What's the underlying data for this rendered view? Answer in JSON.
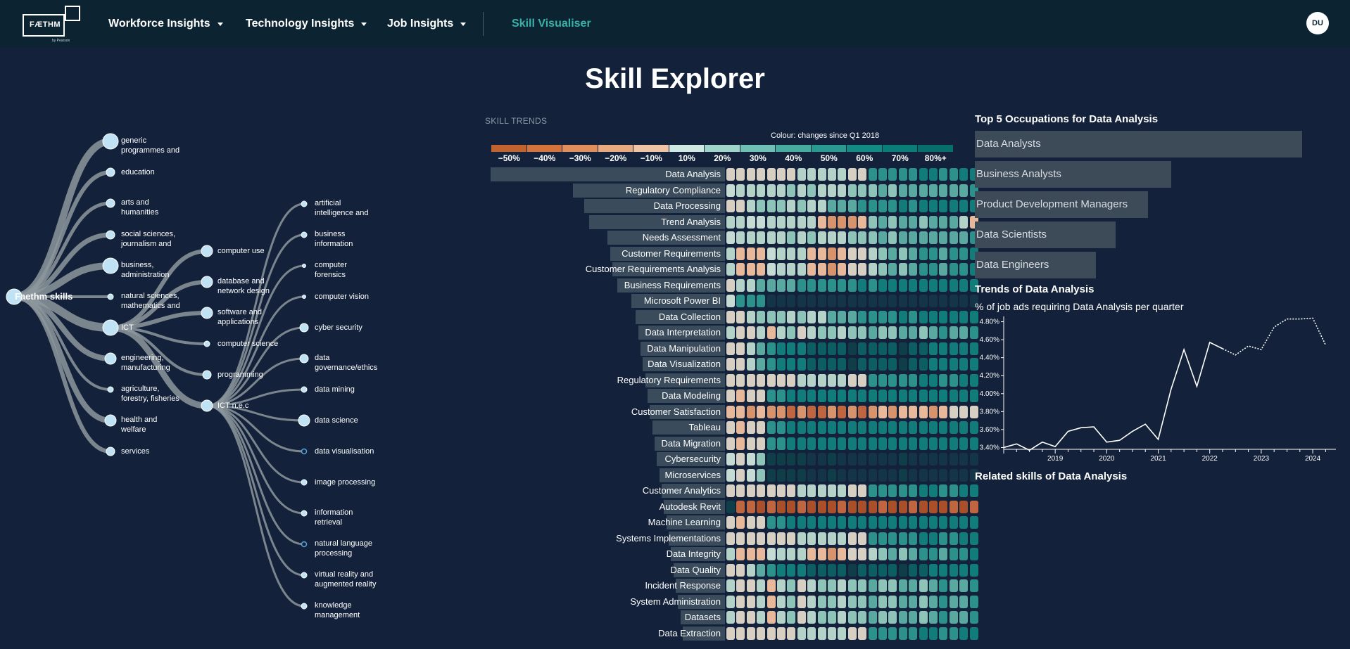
{
  "topbar": {
    "logo_text": "FÆTHM",
    "logo_sub": "by Pearson",
    "nav": [
      {
        "label": "Workforce Insights",
        "dropdown": true
      },
      {
        "label": "Technology Insights",
        "dropdown": true
      },
      {
        "label": "Job Insights",
        "dropdown": true
      },
      {
        "label": "Skill Visualiser",
        "dropdown": false,
        "active": true
      }
    ],
    "user_initials": "DU"
  },
  "page_title": "Skill Explorer",
  "tree": {
    "root": "Faethm skills",
    "categories": [
      {
        "lines": [
          "generic",
          "programmes and"
        ],
        "size": "large"
      },
      {
        "lines": [
          "education"
        ],
        "size": "small"
      },
      {
        "lines": [
          "arts and",
          "humanities"
        ],
        "size": "small"
      },
      {
        "lines": [
          "social sciences,",
          "journalism and"
        ],
        "size": "small"
      },
      {
        "lines": [
          "business,",
          "administration"
        ],
        "size": "large"
      },
      {
        "lines": [
          "natural sciences,",
          "mathematics and"
        ],
        "size": "tiny"
      },
      {
        "lines": [
          "ICT"
        ],
        "size": "large"
      },
      {
        "lines": [
          "engineering,",
          "manufacturing"
        ],
        "size": "medium"
      },
      {
        "lines": [
          "agriculture,",
          "forestry, fisheries"
        ],
        "size": "tiny"
      },
      {
        "lines": [
          "health and",
          "welfare"
        ],
        "size": "medium"
      },
      {
        "lines": [
          "services"
        ],
        "size": "small"
      }
    ],
    "ict_children": [
      {
        "lines": [
          "computer use"
        ],
        "size": "medium"
      },
      {
        "lines": [
          "database and",
          "network design"
        ],
        "size": "medium"
      },
      {
        "lines": [
          "software and",
          "applications"
        ],
        "size": "medium"
      },
      {
        "lines": [
          "computer science"
        ],
        "size": "tiny"
      },
      {
        "lines": [
          "programming"
        ],
        "size": "small"
      },
      {
        "lines": [
          "ICT n.e.c"
        ],
        "size": "medium"
      }
    ],
    "nec_children": [
      {
        "lines": [
          "artificial",
          "intelligence and"
        ],
        "size": "tiny"
      },
      {
        "lines": [
          "business",
          "information"
        ],
        "size": "tiny"
      },
      {
        "lines": [
          "computer",
          "forensics"
        ],
        "size": "dot"
      },
      {
        "lines": [
          "computer vision"
        ],
        "size": "dot"
      },
      {
        "lines": [
          "cyber security"
        ],
        "size": "small"
      },
      {
        "lines": [
          "data",
          "governance/ethics"
        ],
        "size": "small"
      },
      {
        "lines": [
          "data mining"
        ],
        "size": "tiny"
      },
      {
        "lines": [
          "data science"
        ],
        "size": "medium"
      },
      {
        "lines": [
          "data visualisation"
        ],
        "size": "hollow"
      },
      {
        "lines": [
          "image processing"
        ],
        "size": "tiny"
      },
      {
        "lines": [
          "information",
          "retrieval"
        ],
        "size": "tiny"
      },
      {
        "lines": [
          "natural language",
          "processing"
        ],
        "size": "hollow"
      },
      {
        "lines": [
          "virtual reality and",
          "augmented reality"
        ],
        "size": "tiny"
      },
      {
        "lines": [
          "knowledge",
          "management"
        ],
        "size": "tiny"
      }
    ]
  },
  "skill_trends": {
    "section_title": "SKILL TRENDS",
    "colour_caption": "Colour: changes since Q1 2018",
    "scale_labels": [
      "−50%",
      "−40%",
      "−30%",
      "−20%",
      "−10%",
      "10%",
      "20%",
      "30%",
      "40%",
      "50%",
      "60%",
      "70%",
      "80%+"
    ],
    "scale_colors": [
      "#c0632e",
      "#d4743c",
      "#e08e5c",
      "#e8a97e",
      "#efc4a4",
      "#cfe8e2",
      "#9fd4cb",
      "#6fbfb4",
      "#47aba0",
      "#2a9a90",
      "#118b84",
      "#0b7d78",
      "#086e6b"
    ],
    "skills": [
      {
        "name": "Data Analysis",
        "share": 1.0,
        "pattern": "rise_cream"
      },
      {
        "name": "Regulatory Compliance",
        "share": 0.65,
        "pattern": "rise_slow"
      },
      {
        "name": "Data Processing",
        "share": 0.6,
        "pattern": "rise_med"
      },
      {
        "name": "Trend Analysis",
        "share": 0.58,
        "pattern": "trend"
      },
      {
        "name": "Needs Assessment",
        "share": 0.5,
        "pattern": "rise_slow"
      },
      {
        "name": "Customer Requirements",
        "share": 0.49,
        "pattern": "mixed_orange"
      },
      {
        "name": "Customer Requirements Analysis",
        "share": 0.48,
        "pattern": "mixed_orange"
      },
      {
        "name": "Business Requirements",
        "share": 0.46,
        "pattern": "rise_fast"
      },
      {
        "name": "Microsoft Power BI",
        "share": 0.4,
        "pattern": "short"
      },
      {
        "name": "Data Collection",
        "share": 0.38,
        "pattern": "rise_med"
      },
      {
        "name": "Data Interpretation",
        "share": 0.37,
        "pattern": "mixed_light"
      },
      {
        "name": "Data Manipulation",
        "share": 0.36,
        "pattern": "dark_mid"
      },
      {
        "name": "Data Visualization",
        "share": 0.35,
        "pattern": "dark_mid"
      },
      {
        "name": "Regulatory Requirements",
        "share": 0.34,
        "pattern": "rise_cream"
      },
      {
        "name": "Data Modeling",
        "share": 0.33,
        "pattern": "dark_early"
      },
      {
        "name": "Customer Satisfaction",
        "share": 0.32,
        "pattern": "orange_all"
      },
      {
        "name": "Tableau",
        "share": 0.31,
        "pattern": "dark_early"
      },
      {
        "name": "Data Migration",
        "share": 0.3,
        "pattern": "dark_early"
      },
      {
        "name": "Cybersecurity",
        "share": 0.29,
        "pattern": "very_dark"
      },
      {
        "name": "Microservices",
        "share": 0.28,
        "pattern": "very_dark"
      },
      {
        "name": "Customer Analytics",
        "share": 0.27,
        "pattern": "rise_cream"
      },
      {
        "name": "Autodesk Revit",
        "share": 0.26,
        "pattern": "orange_dark"
      },
      {
        "name": "Machine Learning",
        "share": 0.25,
        "pattern": "dark_early"
      },
      {
        "name": "Systems Implementations",
        "share": 0.24,
        "pattern": "rise_cream"
      },
      {
        "name": "Data Integrity",
        "share": 0.23,
        "pattern": "mixed_orange"
      },
      {
        "name": "Data Quality",
        "share": 0.22,
        "pattern": "dark_mid"
      },
      {
        "name": "Incident Response",
        "share": 0.21,
        "pattern": "mixed_light"
      },
      {
        "name": "System Administration",
        "share": 0.2,
        "pattern": "mixed_light"
      },
      {
        "name": "Datasets",
        "share": 0.19,
        "pattern": "mixed_light"
      },
      {
        "name": "Data Extraction",
        "share": 0.18,
        "pattern": "rise_cream"
      }
    ]
  },
  "occupations": {
    "title": "Top 5 Occupations for Data Analysis",
    "items": [
      {
        "name": "Data Analysts",
        "share": 1.0
      },
      {
        "name": "Business Analysts",
        "share": 0.6
      },
      {
        "name": "Product Development Managers",
        "share": 0.53
      },
      {
        "name": "Data Scientists",
        "share": 0.43
      },
      {
        "name": "Data Engineers",
        "share": 0.37
      }
    ]
  },
  "trends": {
    "title": "Trends of Data Analysis",
    "subtitle": "% of job ads requiring Data Analysis per quarter"
  },
  "chart_data": {
    "type": "line",
    "title": "Trends of Data Analysis",
    "subtitle": "% of job ads requiring Data Analysis per quarter",
    "y_ticks": [
      "3.40%",
      "3.60%",
      "3.80%",
      "4.00%",
      "4.20%",
      "4.40%",
      "4.60%",
      "4.80%"
    ],
    "x_ticks": [
      "2019",
      "2020",
      "2021",
      "2022",
      "2023",
      "2024"
    ],
    "ylim": [
      3.38,
      4.82
    ],
    "xlim": [
      2018.0,
      2024.45
    ],
    "series": [
      {
        "name": "",
        "style": "solid",
        "x": [
          2018.0,
          2018.25,
          2018.5,
          2018.75,
          2019.0,
          2019.25,
          2019.5,
          2019.75,
          2020.0,
          2020.25,
          2020.5,
          2020.75,
          2021.0,
          2021.25,
          2021.5,
          2021.75,
          2022.0,
          2022.25
        ],
        "y": [
          3.4,
          3.44,
          3.37,
          3.46,
          3.41,
          3.58,
          3.62,
          3.63,
          3.46,
          3.48,
          3.58,
          3.66,
          3.49,
          4.05,
          4.49,
          4.08,
          4.57,
          4.5
        ]
      },
      {
        "name": "",
        "style": "dotted",
        "x": [
          2022.25,
          2022.5,
          2022.75,
          2023.0,
          2023.25,
          2023.5,
          2023.75,
          2024.0,
          2024.25
        ],
        "y": [
          4.5,
          4.43,
          4.53,
          4.49,
          4.74,
          4.83,
          4.83,
          4.84,
          4.54
        ]
      }
    ]
  },
  "related": {
    "title": "Related skills of Data Analysis"
  }
}
